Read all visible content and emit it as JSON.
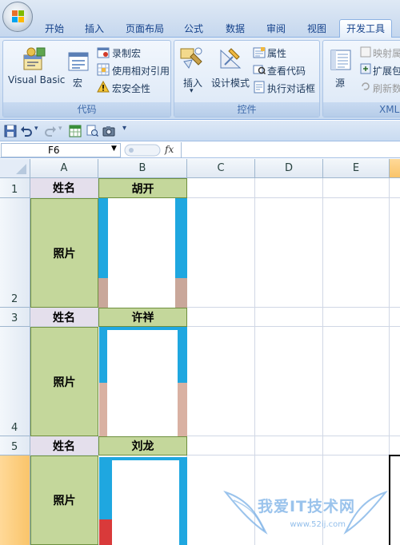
{
  "ribbon": {
    "tabs": [
      "开始",
      "插入",
      "页面布局",
      "公式",
      "数据",
      "审阅",
      "视图",
      "开发工具"
    ],
    "active_tab": "开发工具",
    "code_group": {
      "title": "代码",
      "visual_basic": "Visual Basic",
      "macros": "宏",
      "record_macro": "录制宏",
      "relative_refs": "使用相对引用",
      "macro_security": "宏安全性"
    },
    "controls_group": {
      "title": "控件",
      "insert": "插入",
      "design_mode": "设计模式",
      "properties": "属性",
      "view_code": "查看代码",
      "run_dialog": "执行对话框"
    },
    "xml_group": {
      "title": "XML",
      "source": "源",
      "map_properties": "映射属",
      "expansion_packs": "扩展包",
      "refresh_data": "刷新数"
    }
  },
  "formula_bar": {
    "name_box": "F6",
    "fx": "fx",
    "formula": ""
  },
  "sheet": {
    "columns": [
      "A",
      "B",
      "C",
      "D",
      "E"
    ],
    "rows": [
      "1",
      "2",
      "3",
      "4",
      "5",
      ""
    ],
    "cells": {
      "a1": "姓名",
      "b1": "胡开",
      "a2": "照片",
      "a3": "姓名",
      "b3": "许祥",
      "a4": "照片",
      "a5": "姓名",
      "b5": "刘龙",
      "a6": "照片"
    }
  },
  "watermark": {
    "text": "我爱IT技术网",
    "url": "www.52ij.com"
  },
  "colors": {
    "name_fill": "#e4dfec",
    "value_fill": "#c4d79b",
    "photo_bg": "#1fa7e0",
    "selection_header": "#f9c46a"
  }
}
